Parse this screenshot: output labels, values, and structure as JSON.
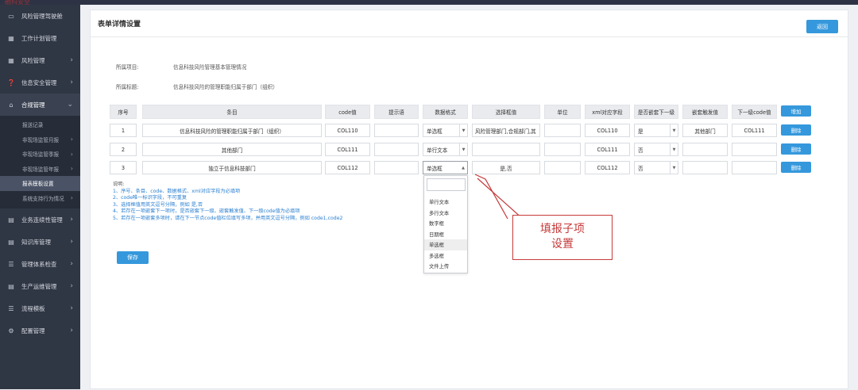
{
  "topbar": {
    "brand": "融科安全"
  },
  "sidebar": {
    "items": [
      {
        "label": "风险管理驾驶舱",
        "icon": "desktop-icon",
        "chevron": false
      },
      {
        "label": "工作计划管理",
        "icon": "calendar-icon",
        "chevron": false
      },
      {
        "label": "风险管理",
        "icon": "calendar-icon",
        "chevron": true
      },
      {
        "label": "信息安全管理",
        "icon": "question-icon",
        "chevron": true
      },
      {
        "label": "合规管理",
        "icon": "inbox-icon",
        "chevron": true,
        "expanded": true
      }
    ],
    "sub_items": [
      {
        "label": "报送记录",
        "chevron": false
      },
      {
        "label": "非现场监管月报",
        "chevron": true
      },
      {
        "label": "非现场监管季报",
        "chevron": true
      },
      {
        "label": "非现场监管年报",
        "chevron": true
      },
      {
        "label": "报表模板设置",
        "chevron": false,
        "active": true
      },
      {
        "label": "系统支持行为情况",
        "chevron": true
      }
    ],
    "items_after": [
      {
        "label": "业务连续性管理",
        "icon": "file-icon",
        "chevron": true
      },
      {
        "label": "知识库管理",
        "icon": "file-icon",
        "chevron": true
      },
      {
        "label": "管理体系检查",
        "icon": "list-icon",
        "chevron": true
      },
      {
        "label": "生产运维管理",
        "icon": "file-icon",
        "chevron": true
      },
      {
        "label": "流程模板",
        "icon": "list-icon",
        "chevron": true
      },
      {
        "label": "配置管理",
        "icon": "gear-icon",
        "chevron": true
      }
    ]
  },
  "page": {
    "title": "表单详情设置",
    "back_label": "返回",
    "project_label": "所属项目:",
    "project_value": "信息科技风险管理基本管理情况",
    "heading_label": "所属标题:",
    "heading_value": "信息科技风险的管理职能归属于部门（组织）"
  },
  "table": {
    "headers": [
      "序号",
      "条目",
      "code值",
      "提示语",
      "数据格式",
      "选择框值",
      "单位",
      "xml对应字段",
      "是否嵌套下一级",
      "嵌套触发值",
      "下一级code值"
    ],
    "add_label": "增加",
    "delete_label": "删除",
    "rows": [
      {
        "index": "1",
        "item": "信息科技风险的管理职能归属于部门（组织）",
        "code": "COL110",
        "hint": "",
        "format": "单选框",
        "options": "风险管理部门,合规部门,其",
        "unit": "",
        "xml": "COL110",
        "nested": "是",
        "trigger": "其他部门",
        "next_code": "COL111"
      },
      {
        "index": "2",
        "item": "其他部门",
        "code": "COL111",
        "hint": "",
        "format": "单行文本",
        "options": "",
        "unit": "",
        "xml": "COL111",
        "nested": "否",
        "trigger": "",
        "next_code": ""
      },
      {
        "index": "3",
        "item": "独立于信息科技部门",
        "code": "COL112",
        "hint": "",
        "format": "单选框",
        "options": "是,否",
        "unit": "",
        "xml": "COL112",
        "nested": "否",
        "trigger": "",
        "next_code": ""
      }
    ]
  },
  "dropdown": {
    "options": [
      "单行文本",
      "多行文本",
      "数字框",
      "日期框",
      "单选框",
      "多选框",
      "文件上传"
    ],
    "highlighted": "单选框"
  },
  "notes": {
    "label": "说明:",
    "lines": [
      "1、序号、条目、code、数据格式、xml对应字段为必填项",
      "2、code唯一标识字段，不可重复",
      "3、选择框值用英文逗号分隔，例如 是,否",
      "4、若存在一项嵌套下一项时，是否嵌套下一级、嵌套触发值、下一级code值为必填项",
      "5、若存在一项嵌套多项时，请在下一节点code值栏位填写多项，并用英文逗号分隔，例如 code1,code2"
    ]
  },
  "save_label": "保存",
  "callout": {
    "line1": "填报子项",
    "line2": "设置"
  },
  "colors": {
    "primary": "#3598dc",
    "sidebar": "#2f3644",
    "callout": "#c63a3a"
  }
}
